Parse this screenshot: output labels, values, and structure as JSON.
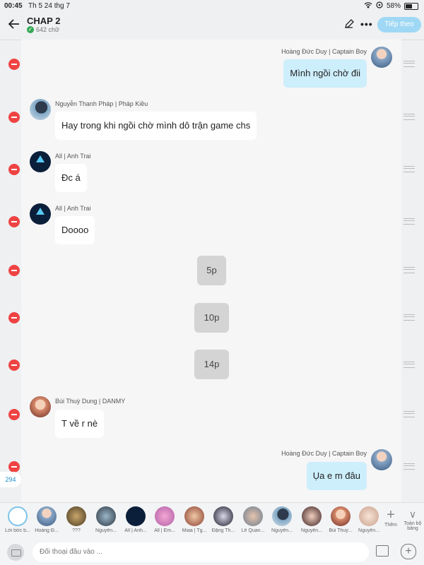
{
  "status_bar": {
    "time": "00:45",
    "date": "Th 5 24 thg 7",
    "battery": "58%"
  },
  "header": {
    "title": "CHAP 2",
    "word_count": "642 chữ",
    "next_label": "Tiếp theo"
  },
  "messages": [
    {
      "kind": "me",
      "sender": "Hoàng Đức Duy | Captain Boy",
      "text": "Mình ngồi chờ đii"
    },
    {
      "kind": "other",
      "sender": "Nguyễn Thanh Pháp | Pháp Kiều",
      "text": "Hay trong khi ngồi chờ mình dô trận game chs"
    },
    {
      "kind": "other",
      "sender": "All | Anh Trai",
      "text": "Đc á"
    },
    {
      "kind": "other",
      "sender": "All | Anh Trai",
      "text": "Doooo"
    },
    {
      "kind": "system",
      "text": "5p"
    },
    {
      "kind": "system",
      "text": "10p"
    },
    {
      "kind": "system",
      "text": "14p"
    },
    {
      "kind": "other",
      "sender": "Bùi Thuỳ Dung | DANMY",
      "text": "T về r nè"
    },
    {
      "kind": "me",
      "sender": "Hoàng Đức Duy | Captain Boy",
      "text": "Ụa e m đâu"
    }
  ],
  "comment_count": "294",
  "characters": [
    {
      "label": "Lời bớc b..."
    },
    {
      "label": "Hoàng Đ..."
    },
    {
      "label": "???"
    },
    {
      "label": "Nguyễn..."
    },
    {
      "label": "All | Anh..."
    },
    {
      "label": "All | Em..."
    },
    {
      "label": "Miaa | Tg..."
    },
    {
      "label": "Đặng Th..."
    },
    {
      "label": "Lê Quan..."
    },
    {
      "label": "Nguyễn..."
    },
    {
      "label": "Nguyễn..."
    },
    {
      "label": "Bùi Thuỳ..."
    },
    {
      "label": "Nguyễn..."
    }
  ],
  "add_label": "Thêm",
  "all_label": "Toàn bộ bảng",
  "input": {
    "placeholder": "Đối thoại đầu vào ..."
  }
}
